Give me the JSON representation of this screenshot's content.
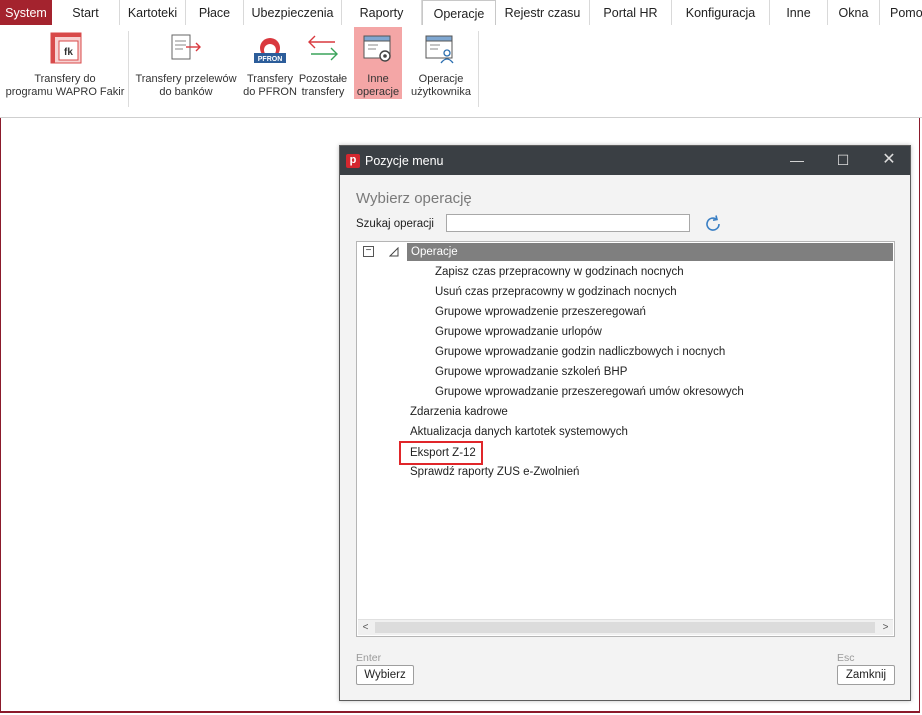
{
  "menubar": {
    "tabs": [
      {
        "label": "System"
      },
      {
        "label": "Start"
      },
      {
        "label": "Kartoteki"
      },
      {
        "label": "Płace"
      },
      {
        "label": "Ubezpieczenia"
      },
      {
        "label": "Raporty"
      },
      {
        "label": "Operacje"
      },
      {
        "label": "Rejestr czasu"
      },
      {
        "label": "Portal HR"
      },
      {
        "label": "Konfiguracja"
      },
      {
        "label": "Inne"
      },
      {
        "label": "Okna"
      },
      {
        "label": "Pomoc"
      }
    ],
    "active_tab": "Operacje"
  },
  "ribbon": {
    "transfer_fakir": {
      "line1": "Transfery do",
      "line2": "programu WAPRO Fakir"
    },
    "transfer_bank": {
      "line1": "Transfery przelewów",
      "line2": "do banków"
    },
    "transfer_pfron": {
      "line1": "Transfery",
      "line2": "do PFRON"
    },
    "other_transfers": {
      "line1": "Pozostałe",
      "line2": "transfery"
    },
    "other_ops": {
      "line1": "Inne",
      "line2": "operacje"
    },
    "user_ops": {
      "line1": "Operacje",
      "line2": "użytkownika"
    },
    "pfron_badge": "PFRON",
    "fk_badge": "fk"
  },
  "dialog": {
    "logo": "p",
    "title": "Pozycje menu",
    "heading": "Wybierz operację",
    "search_label": "Szukaj operacji",
    "search_value": "",
    "tree_header": "Operacje",
    "collapse_symbol": "−",
    "sub_items": [
      "Zapisz czas przepracowny w godzinach nocnych",
      "Usuń czas przepracowny w godzinach nocnych",
      "Grupowe wprowadzenie przeszeregowań",
      "Grupowe wprowadzanie urlopów",
      "Grupowe wprowadzanie godzin nadliczbowych i nocnych",
      "Grupowe wprowadzanie szkoleń BHP",
      "Grupowe wprowadzanie przeszeregowań umów okresowych"
    ],
    "top_items": [
      "Zdarzenia kadrowe",
      "Aktualizacja danych kartotek systemowych",
      "Eksport Z-12",
      "Sprawdź raporty ZUS e-Zwolnień"
    ],
    "enter_hint": "Enter",
    "esc_hint": "Esc",
    "select_button": "Wybierz",
    "close_button": "Zamknij",
    "scroll_left": "<",
    "scroll_right": ">"
  },
  "colors": {
    "brand": "#a4232e",
    "active_ribbon": "#f4a6a6",
    "titlebar": "#3a3f44",
    "highlight_border": "#e0262a"
  }
}
